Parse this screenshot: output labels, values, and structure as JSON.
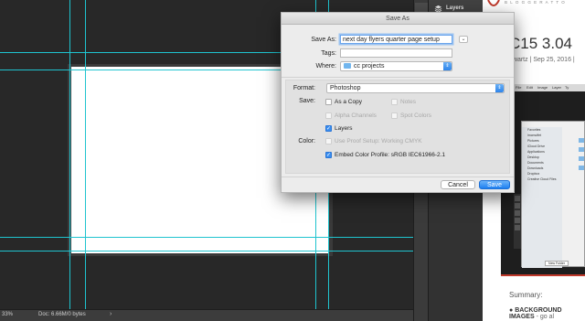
{
  "photoshop": {
    "zoom": "33%",
    "doc_info": "Doc: 6.66M/0 bytes",
    "layers_label": "Layers"
  },
  "dialog": {
    "title": "Save As",
    "save_as_label": "Save As:",
    "save_as_value": "next day flyers quarter page setup",
    "tags_label": "Tags:",
    "tags_value": "",
    "where_label": "Where:",
    "where_value": "cc projects",
    "format_label": "Format:",
    "format_value": "Photoshop",
    "save_label": "Save:",
    "color_label": "Color:",
    "options": {
      "as_a_copy": "As a Copy",
      "notes": "Notes",
      "alpha_channels": "Alpha Channels",
      "spot_colors": "Spot Colors",
      "layers": "Layers",
      "use_proof_setup": "Use Proof Setup:  Working CMYK",
      "embed_color_profile": "Embed Color Profile:  sRGB IEC61966-2.1"
    },
    "checked": {
      "as_a_copy": false,
      "notes": false,
      "alpha_channels": false,
      "spot_colors": false,
      "layers": true,
      "use_proof_setup": false,
      "embed_color_profile": true
    },
    "cancel_button": "Cancel",
    "save_button": "Save"
  },
  "blog": {
    "tagline": "B L O G G E R   A T   T O",
    "title": "C15 3.04",
    "meta": "hwartz | Sep 25, 2016 |",
    "summary": "Summary:",
    "bullet_bold": "BACKGROUND IMAGES",
    "bullet_rest": "- go al",
    "shot_menu": [
      "ps CC",
      "File",
      "Edit",
      "Image",
      "Layer",
      "Ty"
    ],
    "shot_sidebar": [
      "Favorites",
      "lmcmuffet",
      "Pictures",
      "iCloud Drive",
      "Applications",
      "Desktop",
      "Documents",
      "Downloads",
      "Dropbox",
      "Creative Cloud Files"
    ],
    "shot_button": "New Folder"
  },
  "colors": {
    "accent_blue": "#3a8ef0",
    "guide_cyan": "#1fc4cf",
    "blog_red": "#c0392b"
  }
}
